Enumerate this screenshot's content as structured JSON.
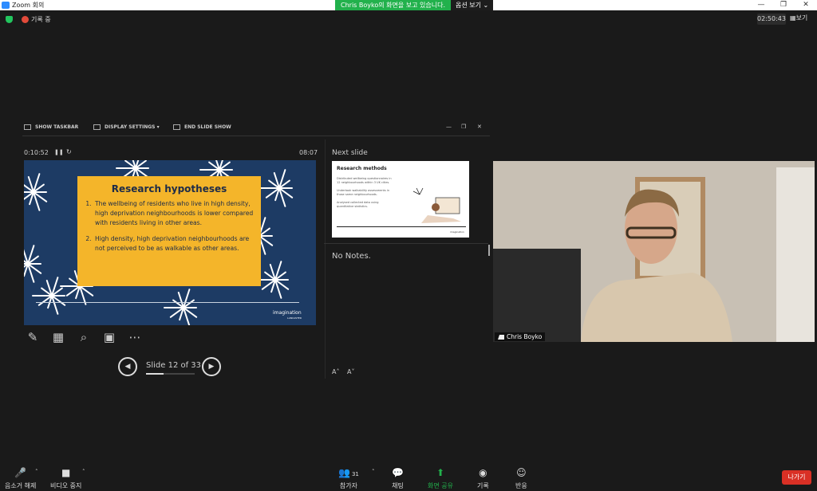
{
  "window": {
    "title": "Zoom 회의",
    "minimize": "—",
    "restore": "❐",
    "close": "✕"
  },
  "share_banner": {
    "message": "Chris Boyko의 화면을 보고 있습니다.",
    "options": "옵션 보기 ⌄"
  },
  "status": {
    "recording": "기록 중",
    "clock": "02:50:43",
    "view": "보기"
  },
  "presenter": {
    "toolbar": {
      "show_taskbar": "SHOW TASKBAR",
      "display_settings": "DISPLAY SETTINGS ▾",
      "end_slide_show": "END SLIDE SHOW"
    },
    "elapsed": "0:10:52",
    "time": "08:07",
    "slide": {
      "title": "Research hypotheses",
      "points": [
        "The wellbeing of residents who live in high density, high deprivation neighbourhoods is lower compared with residents living in other areas.",
        "High density, high deprivation neighbourhoods are not perceived to be as walkable as other areas."
      ],
      "logo": "imagination",
      "logo_sub": "LANCASTER"
    },
    "slide_counter": "Slide 12 of 33",
    "slide_index": 12,
    "slide_total": 33,
    "next_slide_label": "Next slide",
    "next_slide": {
      "title": "Research methods",
      "lines": [
        "Distributed wellbeing questionnaires in 12 neighbourhoods within 3 UK cities.",
        "Undertook walkability assessments in those same neighbourhoods.",
        "Analysed collected data using quantitative statistics."
      ],
      "logo": "imagination"
    },
    "notes": "No Notes.",
    "font_larger": "A˄",
    "font_smaller": "A˅"
  },
  "video": {
    "participant_name": "Chris Boyko"
  },
  "toolbar": {
    "unmute": "음소거 해제",
    "stop_video": "비디오 중지",
    "participants": "참가자",
    "participant_count": "31",
    "chat": "채팅",
    "share_screen": "화면 공유",
    "record": "기록",
    "reactions": "반응",
    "leave": "나가기"
  },
  "colors": {
    "share_green": "#22b14c",
    "leave_red": "#d93025",
    "slide_bg": "#1d3b64",
    "slide_box": "#f4b52a",
    "shield_green": "#22c55e"
  }
}
